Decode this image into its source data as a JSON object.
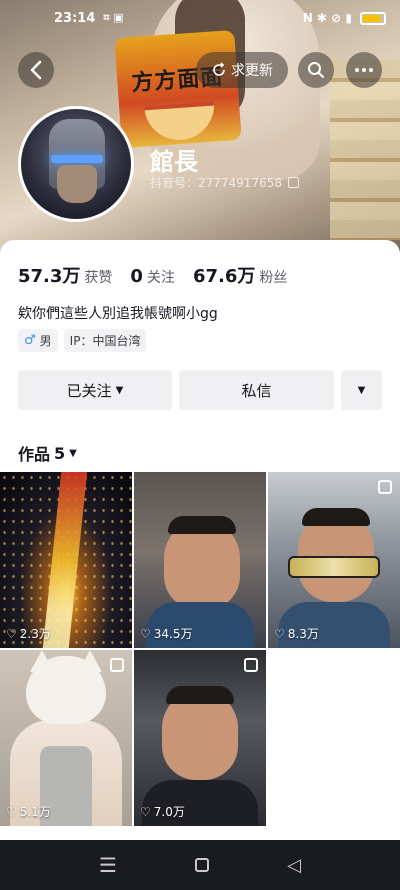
{
  "status_bar": {
    "time": "23:14",
    "left_icons": "⌗ ▣",
    "right_icons": "N ✱ ⊘ ▮"
  },
  "header": {
    "update_label": "求更新",
    "back_icon": "chevron-left-icon",
    "search_icon": "search-icon",
    "more_icon": "more-icon"
  },
  "banner": {
    "product_text": "方方面面"
  },
  "profile": {
    "name": "館長",
    "douyin_id": "抖音号：27774917658"
  },
  "stats": [
    {
      "value": "57.3万",
      "label": "获赞"
    },
    {
      "value": "0",
      "label": "关注"
    },
    {
      "value": "67.6万",
      "label": "粉丝"
    }
  ],
  "bio": "欸你們這些人別追我帳號啊小gg",
  "tags": {
    "gender_icon": "♂",
    "gender": "男",
    "ip": "IP：中国台湾"
  },
  "actions": {
    "follow": "已关注",
    "message": "私信"
  },
  "works": {
    "label": "作品",
    "count": "5"
  },
  "videos": [
    {
      "likes": "2.3万",
      "multi": false
    },
    {
      "likes": "34.5万",
      "multi": false
    },
    {
      "likes": "8.3万",
      "multi": true
    },
    {
      "likes": "5.1万",
      "multi": true
    },
    {
      "likes": "7.0万",
      "multi": true
    }
  ],
  "colors": {
    "male_icon": "#3a8dff",
    "nav_bg": "#1a1b1f"
  }
}
